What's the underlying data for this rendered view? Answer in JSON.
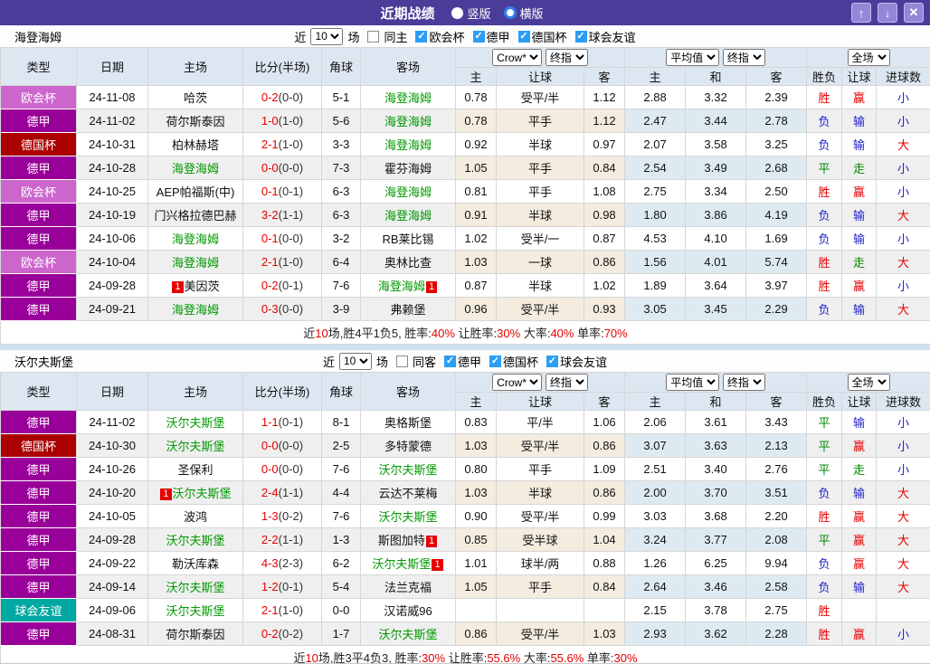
{
  "topbar": {
    "title": "近期战绩",
    "radio_vertical": "竖版",
    "radio_horizontal": "横版",
    "btn_up": "↑",
    "btn_down": "↓",
    "btn_close": "✕"
  },
  "headers": {
    "col_type": "类型",
    "col_date": "日期",
    "col_home": "主场",
    "col_score": "比分(半场)",
    "col_corner": "角球",
    "col_away": "客场",
    "select_bookmaker": "Crow*",
    "select_final": "终指",
    "select_average": "平均值",
    "select_final2": "终指",
    "select_fullmatch": "全场",
    "sub_home": "主",
    "sub_handicap": "让球",
    "sub_away": "客",
    "sub_avg_home": "主",
    "sub_avg_draw": "和",
    "sub_avg_away": "客",
    "sub_result": "胜负",
    "sub_handicap_result": "让球",
    "sub_goals": "进球数"
  },
  "colors": {
    "league_map": {
      "欧会杯": "#cc66cc",
      "德甲": "#990099",
      "德国杯": "#aa0000",
      "球会友谊": "#00a8a2"
    },
    "result_map": {
      "胜": "red-t",
      "负": "blue-t",
      "平": "green-t",
      "赢": "red-t",
      "输": "blue-t",
      "走": "green-t",
      "大": "red-t",
      "小": "blue-t"
    },
    "topbar_bg": "#4a3d99",
    "team_highlight": "#009900",
    "score_red": "#e60000"
  },
  "sections": [
    {
      "team": "海登海姆",
      "filter": {
        "near_label": "近",
        "count": "10",
        "games_label": "场",
        "same_label": "同主",
        "same_checked": false
      },
      "leagues": [
        {
          "label": "欧会杯",
          "checked": true
        },
        {
          "label": "德甲",
          "checked": true
        },
        {
          "label": "德国杯",
          "checked": true
        },
        {
          "label": "球会友谊",
          "checked": true
        }
      ],
      "rows": [
        {
          "league": "欧会杯",
          "date": "24-11-08",
          "home": "哈茨",
          "home_green": false,
          "home_badge": "",
          "score": "0-2",
          "half": "(0-0)",
          "corner": "5-1",
          "away": "海登海姆",
          "away_green": true,
          "away_badge": "",
          "odds": [
            "0.78",
            "受平/半",
            "1.12"
          ],
          "avg": [
            "2.88",
            "3.32",
            "2.39"
          ],
          "result": "胜",
          "handicap": "赢",
          "goals": "小"
        },
        {
          "league": "德甲",
          "date": "24-11-02",
          "home": "荷尔斯泰因",
          "home_green": false,
          "home_badge": "",
          "score": "1-0",
          "half": "(1-0)",
          "corner": "5-6",
          "away": "海登海姆",
          "away_green": true,
          "away_badge": "",
          "odds": [
            "0.78",
            "平手",
            "1.12"
          ],
          "avg": [
            "2.47",
            "3.44",
            "2.78"
          ],
          "result": "负",
          "handicap": "输",
          "goals": "小"
        },
        {
          "league": "德国杯",
          "date": "24-10-31",
          "home": "柏林赫塔",
          "home_green": false,
          "home_badge": "",
          "score": "2-1",
          "half": "(1-0)",
          "corner": "3-3",
          "away": "海登海姆",
          "away_green": true,
          "away_badge": "",
          "odds": [
            "0.92",
            "半球",
            "0.97"
          ],
          "avg": [
            "2.07",
            "3.58",
            "3.25"
          ],
          "result": "负",
          "handicap": "输",
          "goals": "大"
        },
        {
          "league": "德甲",
          "date": "24-10-28",
          "home": "海登海姆",
          "home_green": true,
          "home_badge": "",
          "score": "0-0",
          "half": "(0-0)",
          "corner": "7-3",
          "away": "霍芬海姆",
          "away_green": false,
          "away_badge": "",
          "odds": [
            "1.05",
            "平手",
            "0.84"
          ],
          "avg": [
            "2.54",
            "3.49",
            "2.68"
          ],
          "result": "平",
          "handicap": "走",
          "goals": "小"
        },
        {
          "league": "欧会杯",
          "date": "24-10-25",
          "home": "AEP帕福斯(中)",
          "home_green": false,
          "home_badge": "",
          "score": "0-1",
          "half": "(0-1)",
          "corner": "6-3",
          "away": "海登海姆",
          "away_green": true,
          "away_badge": "",
          "odds": [
            "0.81",
            "平手",
            "1.08"
          ],
          "avg": [
            "2.75",
            "3.34",
            "2.50"
          ],
          "result": "胜",
          "handicap": "赢",
          "goals": "小"
        },
        {
          "league": "德甲",
          "date": "24-10-19",
          "home": "门兴格拉德巴赫",
          "home_green": false,
          "home_badge": "",
          "score": "3-2",
          "half": "(1-1)",
          "corner": "6-3",
          "away": "海登海姆",
          "away_green": true,
          "away_badge": "",
          "odds": [
            "0.91",
            "半球",
            "0.98"
          ],
          "avg": [
            "1.80",
            "3.86",
            "4.19"
          ],
          "result": "负",
          "handicap": "输",
          "goals": "大"
        },
        {
          "league": "德甲",
          "date": "24-10-06",
          "home": "海登海姆",
          "home_green": true,
          "home_badge": "",
          "score": "0-1",
          "half": "(0-0)",
          "corner": "3-2",
          "away": "RB莱比锡",
          "away_green": false,
          "away_badge": "",
          "odds": [
            "1.02",
            "受半/一",
            "0.87"
          ],
          "avg": [
            "4.53",
            "4.10",
            "1.69"
          ],
          "result": "负",
          "handicap": "输",
          "goals": "小"
        },
        {
          "league": "欧会杯",
          "date": "24-10-04",
          "home": "海登海姆",
          "home_green": true,
          "home_badge": "",
          "score": "2-1",
          "half": "(1-0)",
          "corner": "6-4",
          "away": "奥林比查",
          "away_green": false,
          "away_badge": "",
          "odds": [
            "1.03",
            "一球",
            "0.86"
          ],
          "avg": [
            "1.56",
            "4.01",
            "5.74"
          ],
          "result": "胜",
          "handicap": "走",
          "goals": "大"
        },
        {
          "league": "德甲",
          "date": "24-09-28",
          "home": "美因茨",
          "home_green": false,
          "home_badge": "1",
          "score": "0-2",
          "half": "(0-1)",
          "corner": "7-6",
          "away": "海登海姆",
          "away_green": true,
          "away_badge": "1",
          "odds": [
            "0.87",
            "半球",
            "1.02"
          ],
          "avg": [
            "1.89",
            "3.64",
            "3.97"
          ],
          "result": "胜",
          "handicap": "赢",
          "goals": "小"
        },
        {
          "league": "德甲",
          "date": "24-09-21",
          "home": "海登海姆",
          "home_green": true,
          "home_badge": "",
          "score": "0-3",
          "half": "(0-0)",
          "corner": "3-9",
          "away": "弗赖堡",
          "away_green": false,
          "away_badge": "",
          "odds": [
            "0.96",
            "受平/半",
            "0.93"
          ],
          "avg": [
            "3.05",
            "3.45",
            "2.29"
          ],
          "result": "负",
          "handicap": "输",
          "goals": "大"
        }
      ],
      "summary": [
        {
          "text": "近",
          "red": false
        },
        {
          "text": "10",
          "red": true
        },
        {
          "text": "场,胜4平1负5, 胜率:",
          "red": false
        },
        {
          "text": "40%",
          "red": true
        },
        {
          "text": " 让胜率:",
          "red": false
        },
        {
          "text": "30%",
          "red": true
        },
        {
          "text": " 大率:",
          "red": false
        },
        {
          "text": "40%",
          "red": true
        },
        {
          "text": " 单率:",
          "red": false
        },
        {
          "text": "70%",
          "red": true
        }
      ]
    },
    {
      "team": "沃尔夫斯堡",
      "filter": {
        "near_label": "近",
        "count": "10",
        "games_label": "场",
        "same_label": "同客",
        "same_checked": false
      },
      "leagues": [
        {
          "label": "德甲",
          "checked": true
        },
        {
          "label": "德国杯",
          "checked": true
        },
        {
          "label": "球会友谊",
          "checked": true
        }
      ],
      "rows": [
        {
          "league": "德甲",
          "date": "24-11-02",
          "home": "沃尔夫斯堡",
          "home_green": true,
          "home_badge": "",
          "score": "1-1",
          "half": "(0-1)",
          "corner": "8-1",
          "away": "奥格斯堡",
          "away_green": false,
          "away_badge": "",
          "odds": [
            "0.83",
            "平/半",
            "1.06"
          ],
          "avg": [
            "2.06",
            "3.61",
            "3.43"
          ],
          "result": "平",
          "handicap": "输",
          "goals": "小"
        },
        {
          "league": "德国杯",
          "date": "24-10-30",
          "home": "沃尔夫斯堡",
          "home_green": true,
          "home_badge": "",
          "score": "0-0",
          "half": "(0-0)",
          "corner": "2-5",
          "away": "多特蒙德",
          "away_green": false,
          "away_badge": "",
          "odds": [
            "1.03",
            "受平/半",
            "0.86"
          ],
          "avg": [
            "3.07",
            "3.63",
            "2.13"
          ],
          "result": "平",
          "handicap": "赢",
          "goals": "小"
        },
        {
          "league": "德甲",
          "date": "24-10-26",
          "home": "圣保利",
          "home_green": false,
          "home_badge": "",
          "score": "0-0",
          "half": "(0-0)",
          "corner": "7-6",
          "away": "沃尔夫斯堡",
          "away_green": true,
          "away_badge": "",
          "odds": [
            "0.80",
            "平手",
            "1.09"
          ],
          "avg": [
            "2.51",
            "3.40",
            "2.76"
          ],
          "result": "平",
          "handicap": "走",
          "goals": "小"
        },
        {
          "league": "德甲",
          "date": "24-10-20",
          "home": "沃尔夫斯堡",
          "home_green": true,
          "home_badge": "1",
          "score": "2-4",
          "half": "(1-1)",
          "corner": "4-4",
          "away": "云达不莱梅",
          "away_green": false,
          "away_badge": "",
          "odds": [
            "1.03",
            "半球",
            "0.86"
          ],
          "avg": [
            "2.00",
            "3.70",
            "3.51"
          ],
          "result": "负",
          "handicap": "输",
          "goals": "大"
        },
        {
          "league": "德甲",
          "date": "24-10-05",
          "home": "波鸿",
          "home_green": false,
          "home_badge": "",
          "score": "1-3",
          "half": "(0-2)",
          "corner": "7-6",
          "away": "沃尔夫斯堡",
          "away_green": true,
          "away_badge": "",
          "odds": [
            "0.90",
            "受平/半",
            "0.99"
          ],
          "avg": [
            "3.03",
            "3.68",
            "2.20"
          ],
          "result": "胜",
          "handicap": "赢",
          "goals": "大"
        },
        {
          "league": "德甲",
          "date": "24-09-28",
          "home": "沃尔夫斯堡",
          "home_green": true,
          "home_badge": "",
          "score": "2-2",
          "half": "(1-1)",
          "corner": "1-3",
          "away": "斯图加特",
          "away_green": false,
          "away_badge": "1",
          "odds": [
            "0.85",
            "受半球",
            "1.04"
          ],
          "avg": [
            "3.24",
            "3.77",
            "2.08"
          ],
          "result": "平",
          "handicap": "赢",
          "goals": "大"
        },
        {
          "league": "德甲",
          "date": "24-09-22",
          "home": "勒沃库森",
          "home_green": false,
          "home_badge": "",
          "score": "4-3",
          "half": "(2-3)",
          "corner": "6-2",
          "away": "沃尔夫斯堡",
          "away_green": true,
          "away_badge": "1",
          "odds": [
            "1.01",
            "球半/两",
            "0.88"
          ],
          "avg": [
            "1.26",
            "6.25",
            "9.94"
          ],
          "result": "负",
          "handicap": "赢",
          "goals": "大"
        },
        {
          "league": "德甲",
          "date": "24-09-14",
          "home": "沃尔夫斯堡",
          "home_green": true,
          "home_badge": "",
          "score": "1-2",
          "half": "(0-1)",
          "corner": "5-4",
          "away": "法兰克福",
          "away_green": false,
          "away_badge": "",
          "odds": [
            "1.05",
            "平手",
            "0.84"
          ],
          "avg": [
            "2.64",
            "3.46",
            "2.58"
          ],
          "result": "负",
          "handicap": "输",
          "goals": "大"
        },
        {
          "league": "球会友谊",
          "date": "24-09-06",
          "home": "沃尔夫斯堡",
          "home_green": true,
          "home_badge": "",
          "score": "2-1",
          "half": "(1-0)",
          "corner": "0-0",
          "away": "汉诺威96",
          "away_green": false,
          "away_badge": "",
          "odds": [
            "",
            "",
            ""
          ],
          "avg": [
            "2.15",
            "3.78",
            "2.75"
          ],
          "result": "胜",
          "handicap": "",
          "goals": ""
        },
        {
          "league": "德甲",
          "date": "24-08-31",
          "home": "荷尔斯泰因",
          "home_green": false,
          "home_badge": "",
          "score": "0-2",
          "half": "(0-2)",
          "corner": "1-7",
          "away": "沃尔夫斯堡",
          "away_green": true,
          "away_badge": "",
          "odds": [
            "0.86",
            "受平/半",
            "1.03"
          ],
          "avg": [
            "2.93",
            "3.62",
            "2.28"
          ],
          "result": "胜",
          "handicap": "赢",
          "goals": "小"
        }
      ],
      "summary": [
        {
          "text": "近",
          "red": false
        },
        {
          "text": "10",
          "red": true
        },
        {
          "text": "场,胜3平4负3, 胜率:",
          "red": false
        },
        {
          "text": "30%",
          "red": true
        },
        {
          "text": " 让胜率:",
          "red": false
        },
        {
          "text": "55.6%",
          "red": true
        },
        {
          "text": " 大率:",
          "red": false
        },
        {
          "text": "55.6%",
          "red": true
        },
        {
          "text": " 单率:",
          "red": false
        },
        {
          "text": "30%",
          "red": true
        }
      ]
    }
  ]
}
